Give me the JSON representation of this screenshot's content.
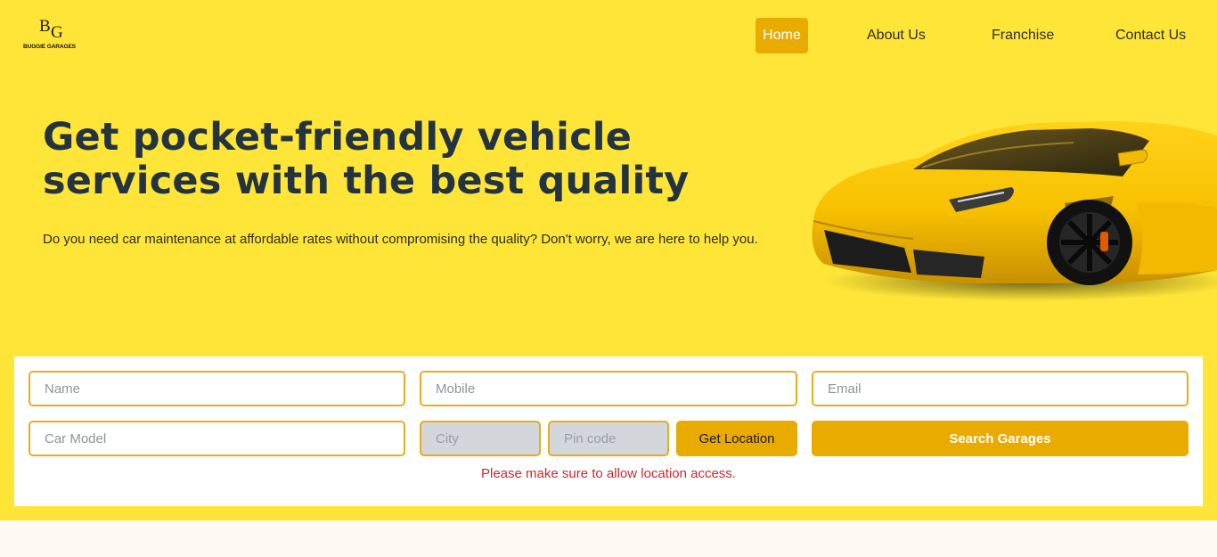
{
  "logo": {
    "mark_b": "B",
    "mark_g": "G",
    "text": "BUGGIE GARAGES"
  },
  "nav": {
    "items": [
      {
        "label": "Home",
        "active": true
      },
      {
        "label": "About Us",
        "active": false
      },
      {
        "label": "Franchise",
        "active": false
      },
      {
        "label": "Contact Us",
        "active": false
      }
    ]
  },
  "hero": {
    "heading_line1": "Get pocket-friendly vehicle",
    "heading_line2": "services with the best quality",
    "subtext": "Do you need car maintenance at affordable rates without compromising the quality? Don't worry, we are here to help you.",
    "image": "yellow-sports-car"
  },
  "form": {
    "name_placeholder": "Name",
    "mobile_placeholder": "Mobile",
    "email_placeholder": "Email",
    "car_model_placeholder": "Car Model",
    "city_placeholder": "City",
    "pin_placeholder": "Pin code",
    "get_location_label": "Get Location",
    "search_label": "Search Garages",
    "warning": "Please make sure to allow location access."
  },
  "colors": {
    "hero_bg": "#ffe537",
    "accent": "#eaab00",
    "heading": "#233340",
    "warning": "#c8292f",
    "page_bg": "#fffbf2"
  }
}
